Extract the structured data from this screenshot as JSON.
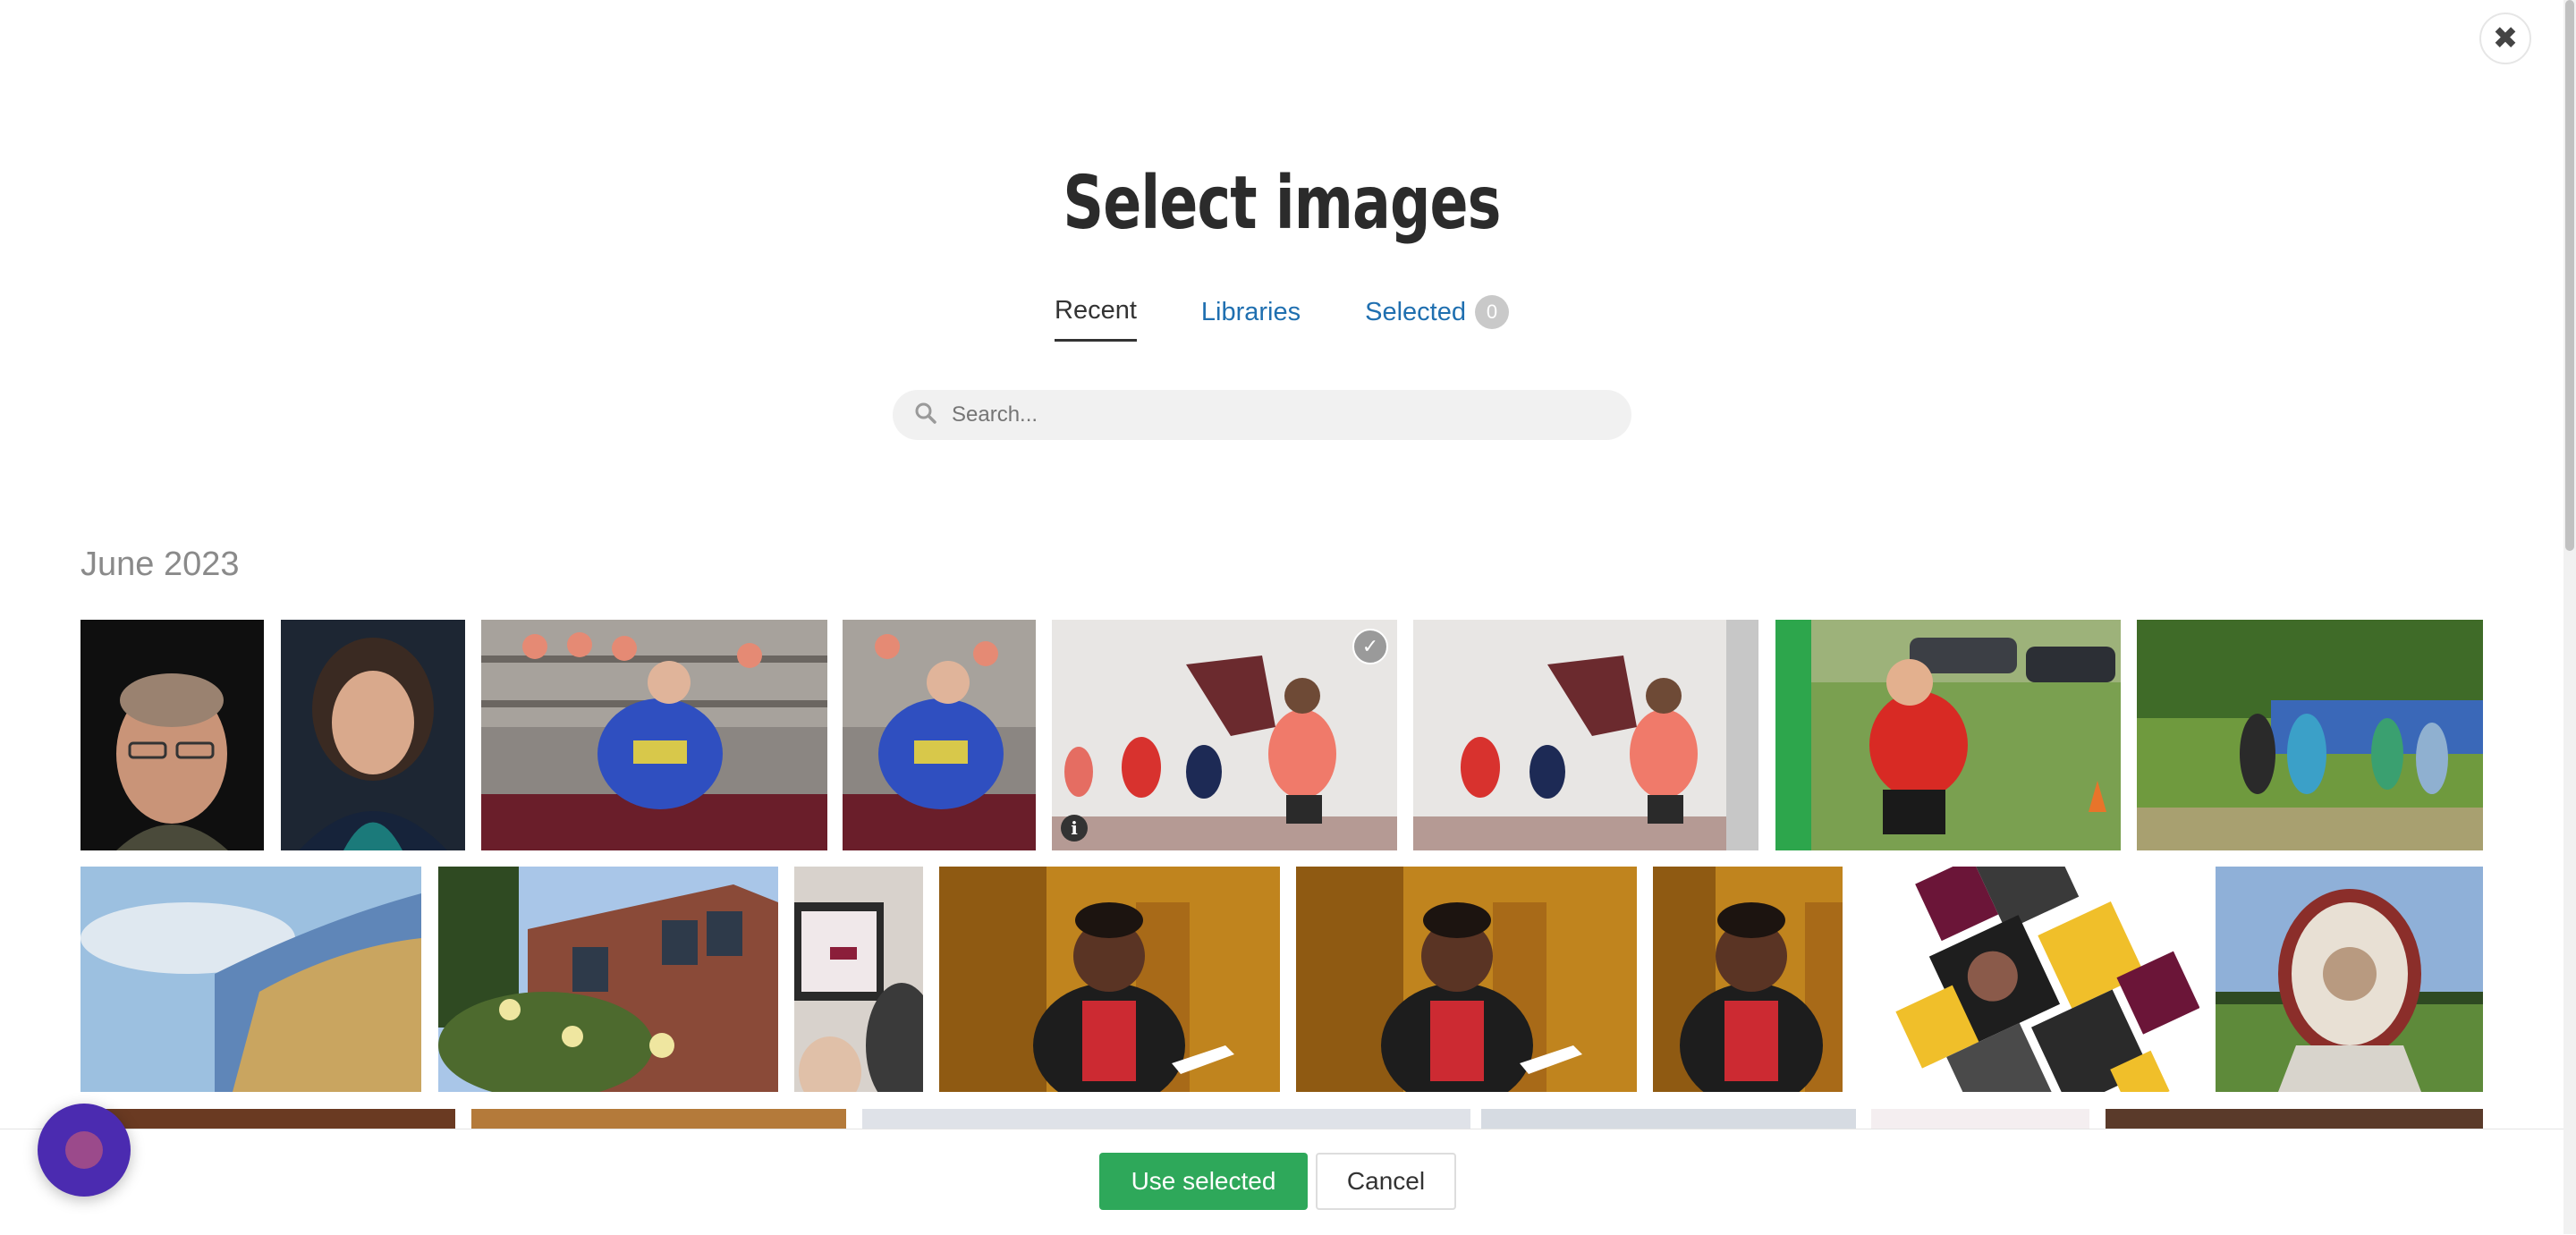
{
  "dialog": {
    "title": "Select images",
    "close_icon": "close-icon"
  },
  "tabs": [
    {
      "label": "Recent",
      "active": true
    },
    {
      "label": "Libraries",
      "active": false
    },
    {
      "label": "Selected",
      "active": false,
      "count": "0"
    }
  ],
  "search": {
    "placeholder": "Search...",
    "value": "",
    "icon": "search-icon"
  },
  "gallery": {
    "section_label": "June 2023"
  },
  "footer": {
    "use_selected_label": "Use selected",
    "cancel_label": "Cancel"
  },
  "colors": {
    "primary_button": "#2ea85a",
    "link": "#1f6fb0",
    "chat_widget": "#4b2bb0"
  }
}
